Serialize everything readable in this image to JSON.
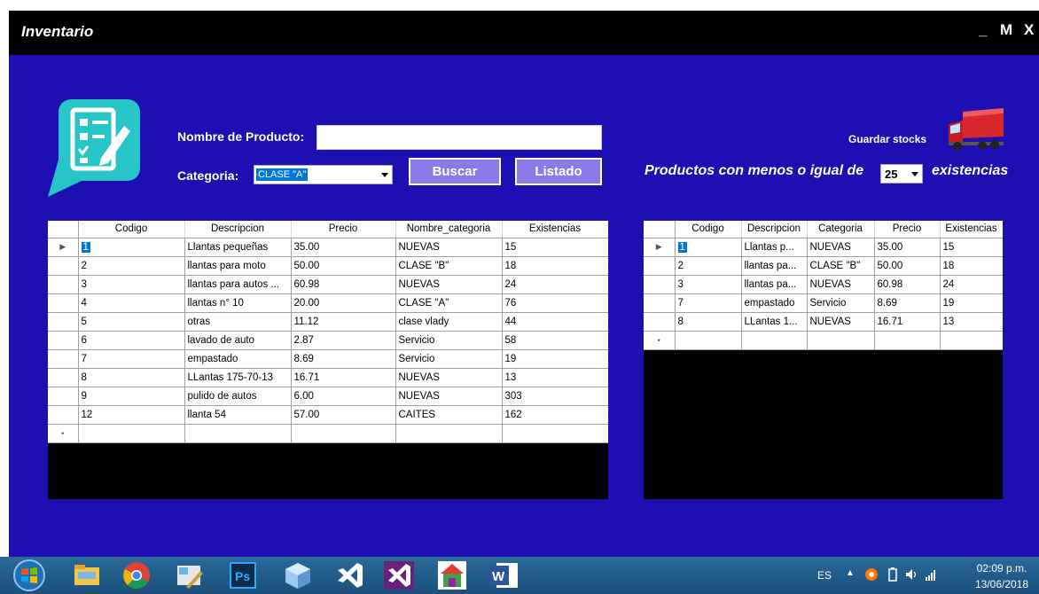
{
  "window": {
    "title": "Inventario",
    "controls": {
      "minimize": "_",
      "maximize": "M",
      "close": "X"
    }
  },
  "search": {
    "nombre_label": "Nombre de Producto:",
    "nombre_value": "",
    "categoria_label": "Categoria:",
    "categoria_value": "CLASE \"A\"",
    "buscar_label": "Buscar",
    "listado_label": "Listado"
  },
  "stock": {
    "guardar_label": "Guardar stocks",
    "productos_label": "Productos con menos o igual de",
    "threshold_value": "25",
    "existencias_label": "existencias"
  },
  "left_grid": {
    "columns": [
      "Codigo",
      "Descripcion",
      "Precio",
      "Nombre_categoria",
      "Existencias"
    ],
    "rows": [
      [
        "1",
        "Llantas pequeñas",
        "35.00",
        "NUEVAS",
        "15"
      ],
      [
        "2",
        "llantas para moto",
        "50.00",
        "CLASE \"B\"",
        "18"
      ],
      [
        "3",
        "llantas para autos ...",
        "60.98",
        "NUEVAS",
        "24"
      ],
      [
        "4",
        "llantas n° 10",
        "20.00",
        "CLASE \"A\"",
        "76"
      ],
      [
        "5",
        "otras",
        "11.12",
        "clase vlady",
        "44"
      ],
      [
        "6",
        "lavado de auto",
        "2.87",
        "Servicio",
        "58"
      ],
      [
        "7",
        "empastado",
        "8.69",
        "Servicio",
        "19"
      ],
      [
        "8",
        "LLantas 175-70-13",
        "16.71",
        "NUEVAS",
        "13"
      ],
      [
        "9",
        "pulido de autos",
        "6.00",
        "NUEVAS",
        "303"
      ],
      [
        "12",
        "llanta 54",
        "57.00",
        "CAITES",
        "162"
      ]
    ]
  },
  "right_grid": {
    "columns": [
      "Codigo",
      "Descripcion",
      "Categoria",
      "Precio",
      "Existencias"
    ],
    "rows": [
      [
        "1",
        "Llantas p...",
        "NUEVAS",
        "35.00",
        "15"
      ],
      [
        "2",
        "llantas pa...",
        "CLASE \"B\"",
        "50.00",
        "18"
      ],
      [
        "3",
        "llantas pa...",
        "NUEVAS",
        "60.98",
        "24"
      ],
      [
        "7",
        "empastado",
        "Servicio",
        "8.69",
        "19"
      ],
      [
        "8",
        "LLantas 1...",
        "NUEVAS",
        "16.71",
        "13"
      ]
    ]
  },
  "row_markers": {
    "current": "▶",
    "new": "•"
  },
  "taskbar": {
    "icons": [
      "windows-start-icon",
      "file-explorer-icon",
      "chrome-icon",
      "tools-icon",
      "photoshop-icon",
      "virtualbox-icon",
      "visual-studio-icon",
      "visual-studio-2-icon",
      "app-icon",
      "word-icon"
    ],
    "photoshop_text": "Ps",
    "word_text": "W",
    "lang": "ES",
    "tray_arrow": "▲",
    "time": "02:09 p.m.",
    "date": "13/06/2018"
  },
  "colors": {
    "main_bg": "#1d0fb2",
    "titlebar_bg": "#000000",
    "button_bg": "#8a7be8",
    "selection": "#0078d7",
    "icon_teal": "#27c4c8"
  }
}
